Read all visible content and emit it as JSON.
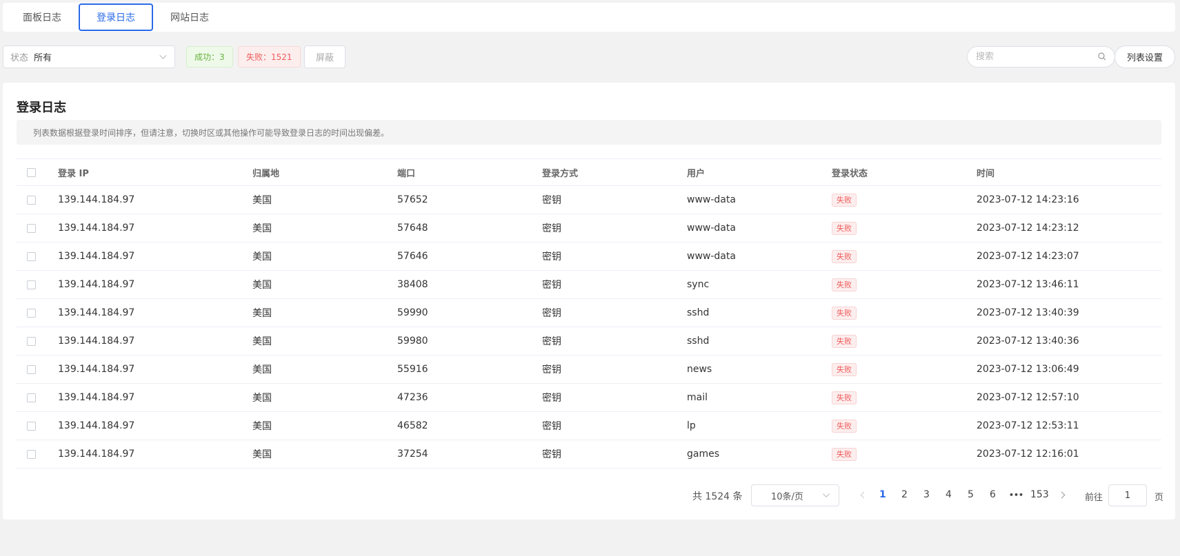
{
  "tabs": [
    "面板日志",
    "登录日志",
    "网站日志"
  ],
  "active_tab": 1,
  "toolbar": {
    "status_label": "状态",
    "status_value": "所有",
    "success_badge": "成功：3",
    "fail_badge": "失败：1521",
    "mask_button": "屏蔽",
    "search_placeholder": "搜索",
    "columns_button": "列表设置"
  },
  "panel": {
    "title": "登录日志",
    "notice": "列表数据根据登录时间排序，但请注意，切换时区或其他操作可能导致登录日志的时间出现偏差。"
  },
  "table": {
    "headers": [
      "登录 IP",
      "归属地",
      "端口",
      "登录方式",
      "用户",
      "登录状态",
      "时间"
    ],
    "rows": [
      {
        "ip": "139.144.184.97",
        "loc": "美国",
        "port": "57652",
        "mode": "密钥",
        "user": "www-data",
        "state": "失败",
        "time": "2023-07-12 14:23:16"
      },
      {
        "ip": "139.144.184.97",
        "loc": "美国",
        "port": "57648",
        "mode": "密钥",
        "user": "www-data",
        "state": "失败",
        "time": "2023-07-12 14:23:12"
      },
      {
        "ip": "139.144.184.97",
        "loc": "美国",
        "port": "57646",
        "mode": "密钥",
        "user": "www-data",
        "state": "失败",
        "time": "2023-07-12 14:23:07"
      },
      {
        "ip": "139.144.184.97",
        "loc": "美国",
        "port": "38408",
        "mode": "密钥",
        "user": "sync",
        "state": "失败",
        "time": "2023-07-12 13:46:11"
      },
      {
        "ip": "139.144.184.97",
        "loc": "美国",
        "port": "59990",
        "mode": "密钥",
        "user": "sshd",
        "state": "失败",
        "time": "2023-07-12 13:40:39"
      },
      {
        "ip": "139.144.184.97",
        "loc": "美国",
        "port": "59980",
        "mode": "密钥",
        "user": "sshd",
        "state": "失败",
        "time": "2023-07-12 13:40:36"
      },
      {
        "ip": "139.144.184.97",
        "loc": "美国",
        "port": "55916",
        "mode": "密钥",
        "user": "news",
        "state": "失败",
        "time": "2023-07-12 13:06:49"
      },
      {
        "ip": "139.144.184.97",
        "loc": "美国",
        "port": "47236",
        "mode": "密钥",
        "user": "mail",
        "state": "失败",
        "time": "2023-07-12 12:57:10"
      },
      {
        "ip": "139.144.184.97",
        "loc": "美国",
        "port": "46582",
        "mode": "密钥",
        "user": "lp",
        "state": "失败",
        "time": "2023-07-12 12:53:11"
      },
      {
        "ip": "139.144.184.97",
        "loc": "美国",
        "port": "37254",
        "mode": "密钥",
        "user": "games",
        "state": "失败",
        "time": "2023-07-12 12:16:01"
      }
    ]
  },
  "pagination": {
    "total": "共 1524 条",
    "page_size": "10条/页",
    "pages": [
      "1",
      "2",
      "3",
      "4",
      "5",
      "6",
      "•••",
      "153"
    ],
    "current_page": "1",
    "goto_label": "前往",
    "goto_value": "1",
    "goto_unit": "页"
  },
  "colors": {
    "accent": "#2a6ae8",
    "success": "#67b33c",
    "fail": "#ef5b5b"
  }
}
